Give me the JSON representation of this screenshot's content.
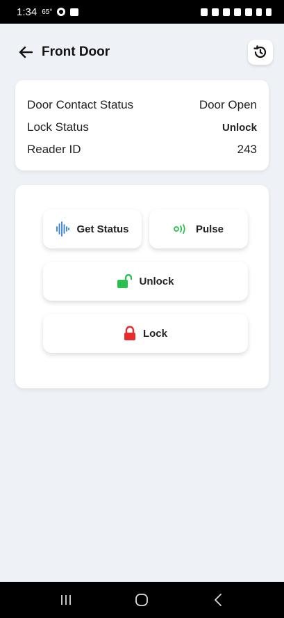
{
  "status_bar": {
    "time": "1:34",
    "temp": "65°"
  },
  "header": {
    "title": "Front Door",
    "back_icon": "arrow-left-icon",
    "history_icon": "history-icon"
  },
  "info": {
    "rows": [
      {
        "label": "Door Contact Status",
        "value": "Door Open"
      },
      {
        "label": "Lock Status",
        "value": "Unlock"
      },
      {
        "label": "Reader ID",
        "value": "243"
      }
    ]
  },
  "actions": {
    "get_status": {
      "label": "Get Status",
      "icon": "sound-wave-icon",
      "color": "#2f7fe0"
    },
    "pulse": {
      "label": "Pulse",
      "icon": "pulse-signal-icon",
      "color": "#2bbf4f"
    },
    "unlock": {
      "label": "Unlock",
      "icon": "unlocked-padlock-icon",
      "color": "#2bbf4f"
    },
    "lock": {
      "label": "Lock",
      "icon": "locked-padlock-icon",
      "color": "#ea2b2b"
    }
  },
  "nav": {
    "recents_icon": "recents-icon",
    "home_icon": "home-icon",
    "back_icon": "back-icon"
  }
}
